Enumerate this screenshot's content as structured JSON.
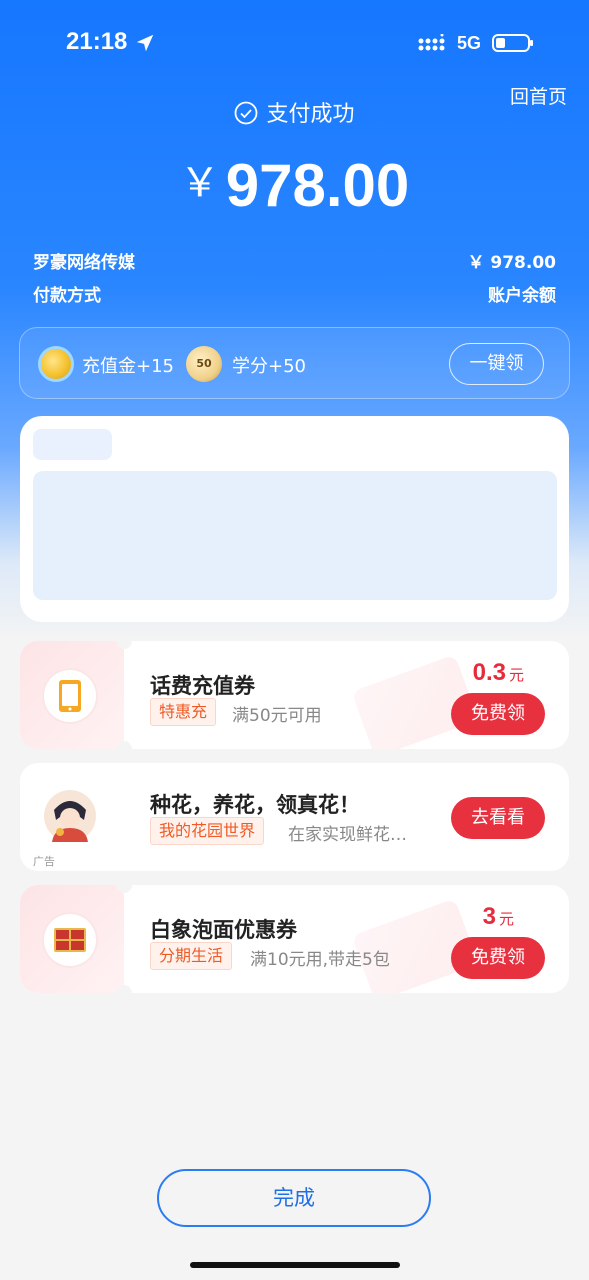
{
  "status_bar": {
    "time": "21:18",
    "network": "5G",
    "battery_level": 0.3
  },
  "header": {
    "home_link": "回首页",
    "title": "支付成功",
    "currency": "￥",
    "amount": "978.00",
    "merchant": "罗豪网络传媒",
    "payment_method_label": "付款方式",
    "paid_amount": "￥ 978.00",
    "payment_method_value": "账户余额"
  },
  "rewards": {
    "item1": "充值金+15",
    "item2_badge": "50",
    "item2": "学分+50",
    "claim_all": "一键领"
  },
  "coupons": [
    {
      "title": "话费充值券",
      "tag": "特惠充",
      "desc": "满50元可用",
      "price": "0.3",
      "unit": "元",
      "button": "免费领",
      "icon": "phone-icon"
    },
    {
      "title": "种花，养花，领真花！",
      "tag": "我的花园世界",
      "desc": "在家实现鲜花…",
      "button": "去看看",
      "ad_label": "广告",
      "icon": "avatar-icon"
    },
    {
      "title": "白象泡面优惠券",
      "tag": "分期生活",
      "desc": "满10元用,带走5包",
      "price": "3",
      "unit": "元",
      "button": "免费领",
      "icon": "noodle-pack-icon"
    }
  ],
  "footer": {
    "done_button": "完成"
  },
  "colors": {
    "brand_blue": "#1677ff",
    "accent_red": "#e8313f",
    "tag_orange": "#ef5b27"
  }
}
